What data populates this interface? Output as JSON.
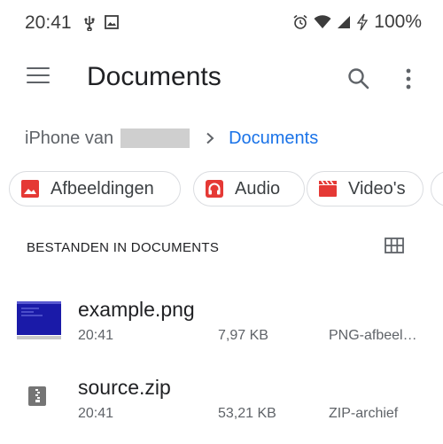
{
  "status_bar": {
    "time": "20:41",
    "battery": "100%"
  },
  "toolbar": {
    "title": "Documents"
  },
  "breadcrumb": {
    "root": "iPhone van",
    "current": "Documents"
  },
  "chips": [
    {
      "label": "Afbeeldingen",
      "icon": "image-icon",
      "color": "#e53935"
    },
    {
      "label": "Audio",
      "icon": "headphones-icon",
      "color": "#e53935"
    },
    {
      "label": "Video's",
      "icon": "video-clapper-icon",
      "color": "#e53935"
    }
  ],
  "section": {
    "header": "BESTANDEN IN DOCUMENTS"
  },
  "files": [
    {
      "name": "example.png",
      "time": "20:41",
      "size": "7,97  KB",
      "type": "PNG-afbeel…",
      "icon": "png-thumbnail"
    },
    {
      "name": "source.zip",
      "time": "20:41",
      "size": "53,21  KB",
      "type": "ZIP-archief",
      "icon": "zip-archive-icon"
    }
  ],
  "colors": {
    "accent": "#1a73e8",
    "chip_icon_red": "#e53935",
    "text_secondary": "#5f6368"
  }
}
